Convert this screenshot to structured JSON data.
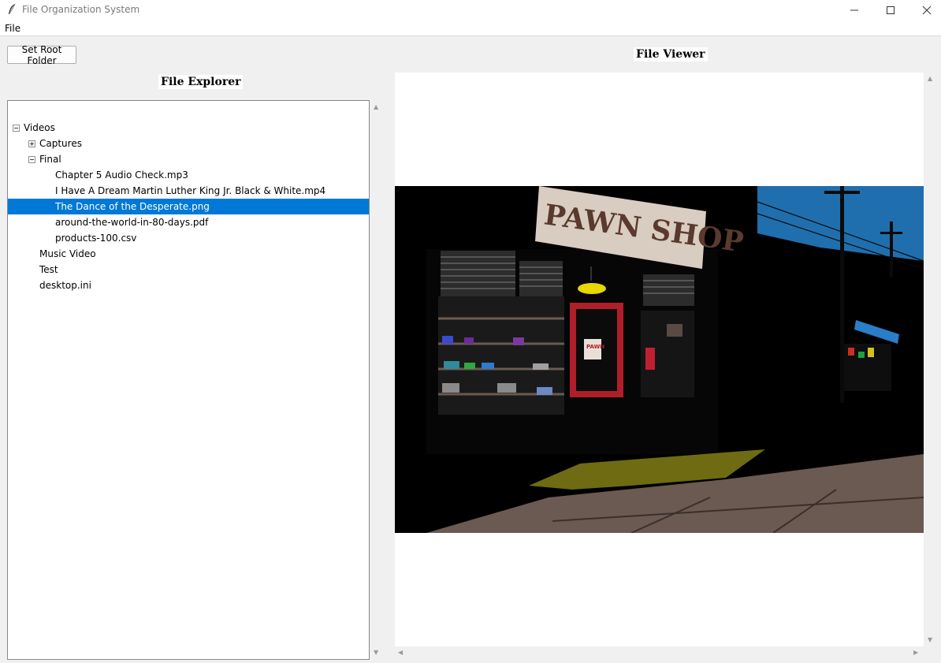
{
  "window": {
    "title": "File Organization System",
    "controls": {
      "minimize": "—",
      "maximize": "☐",
      "close": "✕"
    }
  },
  "menu": {
    "file": "File"
  },
  "toolbar": {
    "set_root_label": "Set Root Folder"
  },
  "explorer": {
    "heading": "File Explorer",
    "tree": [
      {
        "label": "Videos",
        "depth": 0,
        "expander": "minus",
        "selected": false
      },
      {
        "label": "Captures",
        "depth": 1,
        "expander": "plus",
        "selected": false
      },
      {
        "label": "Final",
        "depth": 1,
        "expander": "minus",
        "selected": false
      },
      {
        "label": "Chapter 5 Audio Check.mp3",
        "depth": 2,
        "expander": "none",
        "selected": false
      },
      {
        "label": "I Have A Dream Martin Luther King Jr. Black & White.mp4",
        "depth": 2,
        "expander": "none",
        "selected": false
      },
      {
        "label": "The Dance of the Desperate.png",
        "depth": 2,
        "expander": "none",
        "selected": true
      },
      {
        "label": "around-the-world-in-80-days.pdf",
        "depth": 2,
        "expander": "none",
        "selected": false
      },
      {
        "label": "products-100.csv",
        "depth": 2,
        "expander": "none",
        "selected": false
      },
      {
        "label": "Music Video",
        "depth": 1,
        "expander": "none",
        "selected": false
      },
      {
        "label": "Test",
        "depth": 1,
        "expander": "none",
        "selected": false
      },
      {
        "label": "desktop.ini",
        "depth": 1,
        "expander": "none",
        "selected": false
      }
    ]
  },
  "viewer": {
    "heading": "File Viewer",
    "image_sign": "PAWN SHOP",
    "door_sign": "PAWN"
  },
  "colors": {
    "selection": "#0078d7",
    "sky": "#1f6fae",
    "sign": "#d9ccc0",
    "sunlit_pavement": "#6e6b12",
    "sidewalk": "#6b5a52",
    "door": "#b01e2a"
  }
}
